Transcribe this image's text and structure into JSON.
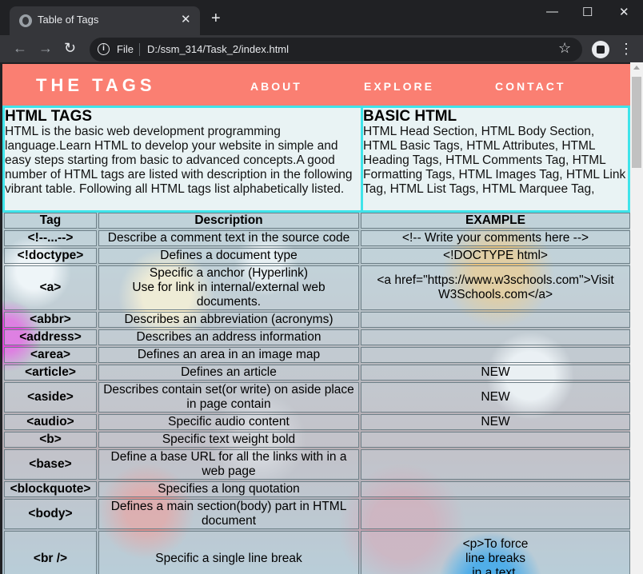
{
  "browser": {
    "tab_title": "Table of Tags",
    "tab_close": "✕",
    "new_tab": "+",
    "win_min": "—",
    "win_max": "☐",
    "win_close": "✕",
    "back": "←",
    "forward": "→",
    "reload": "↻",
    "info": "i",
    "file_label": "File",
    "url": "D:/ssm_314/Task_2/index.html",
    "star": "☆",
    "menu": "⋮"
  },
  "navbar": {
    "brand": "THE TAGS",
    "links": [
      "ABOUT",
      "EXPLORE",
      "CONTACT"
    ],
    "color": "#fa7f72"
  },
  "intro": {
    "left_title": "HTML TAGS",
    "left_text": "HTML is the basic web development programming language.Learn HTML to develop your website in simple and easy steps starting from basic to advanced concepts.A good number of HTML tags are listed with description in the following vibrant table. Following all HTML tags list alphabetically listed.",
    "right_title": "BASIC HTML",
    "right_text": "HTML Head Section, HTML Body Section, HTML Basic Tags, HTML Attributes, HTML Heading Tags, HTML Comments Tag, HTML Formatting Tags, HTML Images Tag, HTML Link Tag, HTML List Tags, HTML Marquee Tag,",
    "border_color": "#3fe4ea"
  },
  "table": {
    "headers": [
      "Tag",
      "Description",
      "EXAMPLE"
    ],
    "rows": [
      {
        "tag": "<!--...-->",
        "desc": "Describe a comment text in the source code",
        "example": "<!-- Write your comments here -->"
      },
      {
        "tag": "<!doctype>",
        "desc": "Defines a document type",
        "example": "<!DOCTYPE html>"
      },
      {
        "tag": "<a>",
        "desc": "Specific a anchor (Hyperlink)\nUse for link in internal/external web documents.",
        "example": "<a href=\"https://www.w3schools.com\">Visit W3Schools.com</a>"
      },
      {
        "tag": "<abbr>",
        "desc": "Describes an abbreviation (acronyms)",
        "example": ""
      },
      {
        "tag": "<address>",
        "desc": "Describes an address information",
        "example": ""
      },
      {
        "tag": "<area>",
        "desc": "Defines an area in an image map",
        "example": ""
      },
      {
        "tag": "<article>",
        "desc": "Defines an article",
        "example": "NEW"
      },
      {
        "tag": "<aside>",
        "desc": "Describes contain set(or write) on aside place in page contain",
        "example": "NEW"
      },
      {
        "tag": "<audio>",
        "desc": "Specific audio content",
        "example": "NEW"
      },
      {
        "tag": "<b>",
        "desc": "Specific text weight bold",
        "example": ""
      },
      {
        "tag": "<base>",
        "desc": "Define a base URL for all the links with in a web page",
        "example": ""
      },
      {
        "tag": "<blockquote>",
        "desc": "Specifies a long quotation",
        "example": ""
      },
      {
        "tag": "<body>",
        "desc": "Defines a main section(body) part in HTML document",
        "example": ""
      },
      {
        "tag": "<br />",
        "desc": "Specific a single line break",
        "example": "<p>To force\nline breaks\nin a text,"
      }
    ]
  }
}
